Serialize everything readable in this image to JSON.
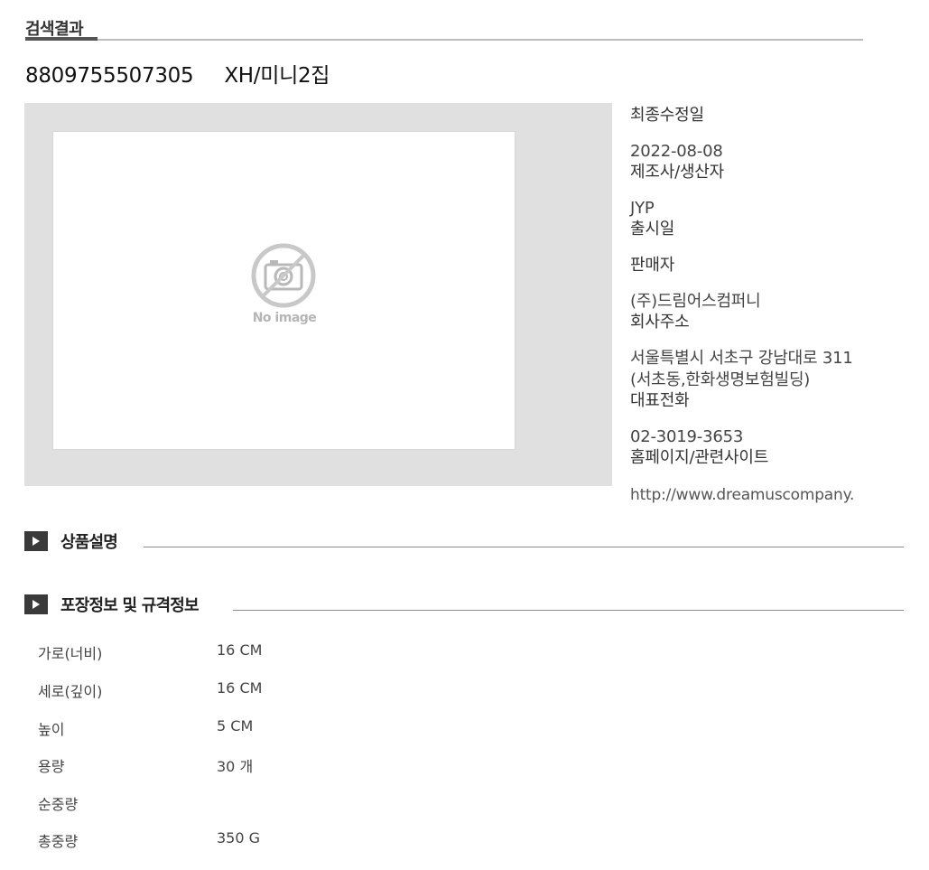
{
  "tab": {
    "label": "검색결과"
  },
  "product": {
    "barcode": "8809755507305",
    "name": "XH/미니2집"
  },
  "image": {
    "placeholder_text": "No image",
    "icon": "no-camera-icon"
  },
  "info": {
    "last_modified_label": "최종수정일",
    "last_modified_value": "2022-08-08",
    "manufacturer_label": "제조사/생산자",
    "manufacturer_value": "JYP",
    "release_label": "출시일",
    "seller_label": "판매자",
    "seller_value": "(주)드림어스컴퍼니",
    "address_label": "회사주소",
    "address_line1": "서울특별시 서초구 강남대로 311",
    "address_line2": "(서초동,한화생명보험빌딩)",
    "phone_label": "대표전화",
    "phone_value": "02-3019-3653",
    "homepage_label": "홈페이지/관련사이트",
    "homepage_value": "http://www.dreamuscompany."
  },
  "sections": {
    "description": "상품설명",
    "packaging": "포장정보 및 규격정보"
  },
  "specs": [
    {
      "label": "가로(너비)",
      "value": "16 CM"
    },
    {
      "label": "세로(깊이)",
      "value": "16 CM"
    },
    {
      "label": "높이",
      "value": "5 CM"
    },
    {
      "label": "용량",
      "value": "30 개"
    },
    {
      "label": "순중량",
      "value": ""
    },
    {
      "label": "총중량",
      "value": "350 G"
    }
  ],
  "colors": {
    "frame_bg": "#e0e0e0",
    "bullet_bg": "#3a3a3a",
    "muted_text": "#b5b5b5"
  }
}
